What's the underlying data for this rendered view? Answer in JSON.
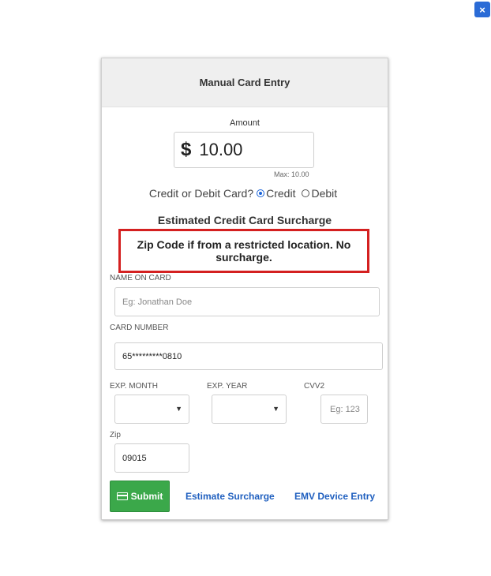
{
  "close_button": {
    "label": "×"
  },
  "dialog": {
    "title": "Manual Card Entry",
    "amount": {
      "label": "Amount",
      "currency_symbol": "$",
      "value": "10.00",
      "max_note": "Max: 10.00"
    },
    "card_type": {
      "label": "Credit or Debit Card?",
      "options": [
        {
          "label": "Credit",
          "selected": true
        },
        {
          "label": "Debit",
          "selected": false
        }
      ]
    },
    "surcharge_title": "Estimated Credit Card Surcharge",
    "surcharge_message": "Zip Code if from a restricted location. No surcharge.",
    "fields": {
      "name_on_card": {
        "label": "NAME ON CARD",
        "placeholder": "Eg: Jonathan Doe"
      },
      "card_number": {
        "label": "CARD NUMBER",
        "value": "65*********0810"
      },
      "exp_month": {
        "label": "EXP. MONTH",
        "value": ""
      },
      "exp_year": {
        "label": "EXP. YEAR",
        "value": ""
      },
      "cvv2": {
        "label": "CVV2",
        "placeholder": "Eg: 123"
      },
      "zip": {
        "label": "Zip",
        "value": "09015"
      }
    },
    "actions": {
      "submit_label": "Submit",
      "estimate_label": "Estimate Surcharge",
      "emv_label": "EMV Device Entry"
    }
  },
  "colors": {
    "accent_blue": "#1f5fbf",
    "submit_green": "#3ba84a",
    "warning_red": "#d42020",
    "header_gray": "#efefef"
  }
}
